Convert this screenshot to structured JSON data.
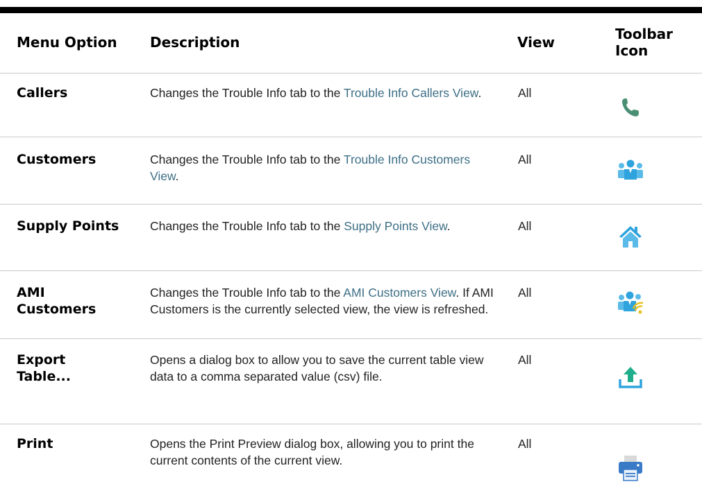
{
  "table": {
    "headers": {
      "menu_option": "Menu Option",
      "description": "Description",
      "view": "View",
      "toolbar_icon_line1": "Toolbar",
      "toolbar_icon_line2": "Icon"
    },
    "rows": [
      {
        "option": "Callers",
        "desc_before": "Changes the Trouble Info tab to the ",
        "desc_link": "Trouble Info Callers View",
        "desc_after": ".",
        "view": "All",
        "icon": "phone-icon"
      },
      {
        "option": "Customers",
        "desc_before": "Changes the Trouble Info tab to the ",
        "desc_link": "Trouble Info Customers View",
        "desc_after": ".",
        "view": "All",
        "icon": "customers-icon"
      },
      {
        "option": "Supply Points",
        "desc_before": "Changes the Trouble Info tab to the ",
        "desc_link": "Supply Points View",
        "desc_after": ".",
        "view": "All",
        "icon": "home-icon"
      },
      {
        "option": "AMI Customers",
        "desc_before": "Changes the Trouble Info tab to the ",
        "desc_link": "AMI Customers View",
        "desc_after": ". If AMI Customers is the currently selected view, the view is refreshed.",
        "view": "All",
        "icon": "ami-customers-icon"
      },
      {
        "option": "Export Table...",
        "desc_before": "Opens a dialog box to allow you to save the current table view data to a comma separated value (csv) file.",
        "desc_link": "",
        "desc_after": "",
        "view": "All",
        "icon": "export-icon"
      },
      {
        "option": "Print",
        "desc_before": "Opens the Print Preview dialog box, allowing you to print the current contents of the current view.",
        "desc_link": "",
        "desc_after": "",
        "view": "All",
        "icon": "printer-icon"
      }
    ]
  },
  "colors": {
    "link": "#3d6f86",
    "phone_icon": "#4a8f73",
    "people_icon": "#2ea3dd",
    "people_icon_light": "#5bbbe8",
    "wifi_icon": "#e9c21f",
    "printer_icon": "#3a7bc8"
  }
}
